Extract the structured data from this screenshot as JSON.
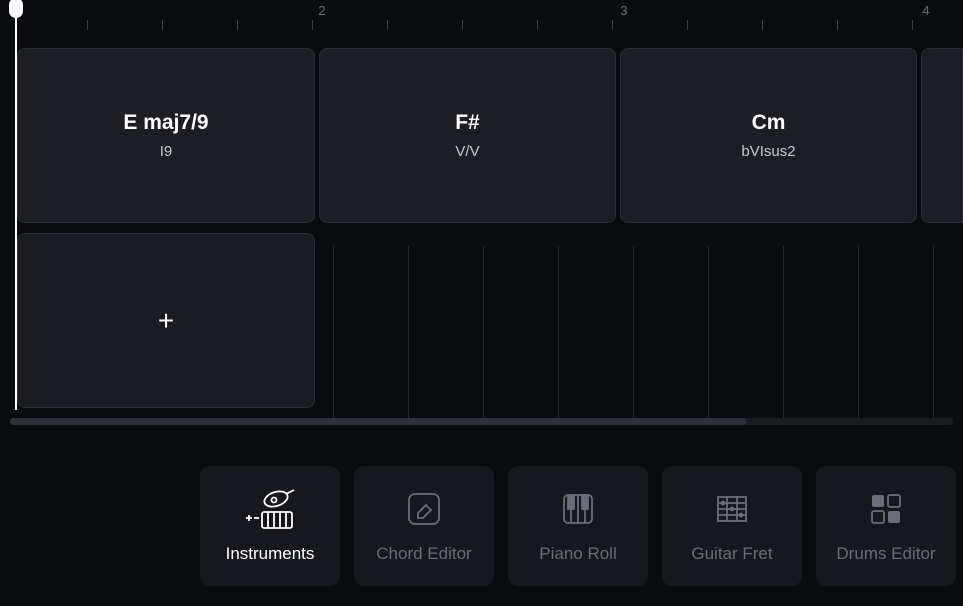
{
  "ruler": {
    "marks": [
      {
        "pos": 322,
        "label": "2"
      },
      {
        "pos": 624,
        "label": "3"
      },
      {
        "pos": 926,
        "label": "4"
      }
    ]
  },
  "chords": [
    {
      "name": "E maj7/9",
      "roman": "I9"
    },
    {
      "name": "F#",
      "roman": "V/V"
    },
    {
      "name": "Cm",
      "roman": "bVIsus2"
    }
  ],
  "tabs": [
    {
      "id": "instruments",
      "label": "Instruments",
      "active": true
    },
    {
      "id": "chord-editor",
      "label": "Chord Editor",
      "active": false
    },
    {
      "id": "piano-roll",
      "label": "Piano Roll",
      "active": false
    },
    {
      "id": "guitar-fret",
      "label": "Guitar Fret",
      "active": false
    },
    {
      "id": "drums-editor",
      "label": "Drums Editor",
      "active": false
    }
  ]
}
